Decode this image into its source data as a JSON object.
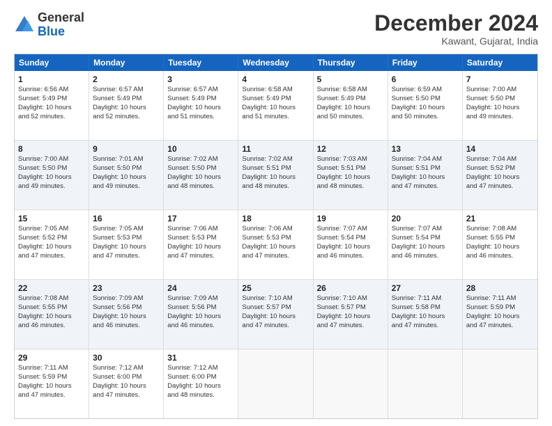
{
  "logo": {
    "general": "General",
    "blue": "Blue"
  },
  "header": {
    "month": "December 2024",
    "location": "Kawant, Gujarat, India"
  },
  "days": [
    "Sunday",
    "Monday",
    "Tuesday",
    "Wednesday",
    "Thursday",
    "Friday",
    "Saturday"
  ],
  "rows": [
    [
      {
        "num": "",
        "empty": true
      },
      {
        "num": "1",
        "lines": [
          "Sunrise: 6:56 AM",
          "Sunset: 5:49 PM",
          "Daylight: 10 hours",
          "and 52 minutes."
        ]
      },
      {
        "num": "2",
        "lines": [
          "Sunrise: 6:57 AM",
          "Sunset: 5:49 PM",
          "Daylight: 10 hours",
          "and 52 minutes."
        ]
      },
      {
        "num": "3",
        "lines": [
          "Sunrise: 6:57 AM",
          "Sunset: 5:49 PM",
          "Daylight: 10 hours",
          "and 51 minutes."
        ]
      },
      {
        "num": "4",
        "lines": [
          "Sunrise: 6:58 AM",
          "Sunset: 5:49 PM",
          "Daylight: 10 hours",
          "and 51 minutes."
        ]
      },
      {
        "num": "5",
        "lines": [
          "Sunrise: 6:58 AM",
          "Sunset: 5:49 PM",
          "Daylight: 10 hours",
          "and 50 minutes."
        ]
      },
      {
        "num": "6",
        "lines": [
          "Sunrise: 6:59 AM",
          "Sunset: 5:50 PM",
          "Daylight: 10 hours",
          "and 50 minutes."
        ]
      },
      {
        "num": "7",
        "lines": [
          "Sunrise: 7:00 AM",
          "Sunset: 5:50 PM",
          "Daylight: 10 hours",
          "and 49 minutes."
        ]
      }
    ],
    [
      {
        "num": "8",
        "lines": [
          "Sunrise: 7:00 AM",
          "Sunset: 5:50 PM",
          "Daylight: 10 hours",
          "and 49 minutes."
        ]
      },
      {
        "num": "9",
        "lines": [
          "Sunrise: 7:01 AM",
          "Sunset: 5:50 PM",
          "Daylight: 10 hours",
          "and 49 minutes."
        ]
      },
      {
        "num": "10",
        "lines": [
          "Sunrise: 7:02 AM",
          "Sunset: 5:50 PM",
          "Daylight: 10 hours",
          "and 48 minutes."
        ]
      },
      {
        "num": "11",
        "lines": [
          "Sunrise: 7:02 AM",
          "Sunset: 5:51 PM",
          "Daylight: 10 hours",
          "and 48 minutes."
        ]
      },
      {
        "num": "12",
        "lines": [
          "Sunrise: 7:03 AM",
          "Sunset: 5:51 PM",
          "Daylight: 10 hours",
          "and 48 minutes."
        ]
      },
      {
        "num": "13",
        "lines": [
          "Sunrise: 7:04 AM",
          "Sunset: 5:51 PM",
          "Daylight: 10 hours",
          "and 47 minutes."
        ]
      },
      {
        "num": "14",
        "lines": [
          "Sunrise: 7:04 AM",
          "Sunset: 5:52 PM",
          "Daylight: 10 hours",
          "and 47 minutes."
        ]
      }
    ],
    [
      {
        "num": "15",
        "lines": [
          "Sunrise: 7:05 AM",
          "Sunset: 5:52 PM",
          "Daylight: 10 hours",
          "and 47 minutes."
        ]
      },
      {
        "num": "16",
        "lines": [
          "Sunrise: 7:05 AM",
          "Sunset: 5:53 PM",
          "Daylight: 10 hours",
          "and 47 minutes."
        ]
      },
      {
        "num": "17",
        "lines": [
          "Sunrise: 7:06 AM",
          "Sunset: 5:53 PM",
          "Daylight: 10 hours",
          "and 47 minutes."
        ]
      },
      {
        "num": "18",
        "lines": [
          "Sunrise: 7:06 AM",
          "Sunset: 5:53 PM",
          "Daylight: 10 hours",
          "and 47 minutes."
        ]
      },
      {
        "num": "19",
        "lines": [
          "Sunrise: 7:07 AM",
          "Sunset: 5:54 PM",
          "Daylight: 10 hours",
          "and 46 minutes."
        ]
      },
      {
        "num": "20",
        "lines": [
          "Sunrise: 7:07 AM",
          "Sunset: 5:54 PM",
          "Daylight: 10 hours",
          "and 46 minutes."
        ]
      },
      {
        "num": "21",
        "lines": [
          "Sunrise: 7:08 AM",
          "Sunset: 5:55 PM",
          "Daylight: 10 hours",
          "and 46 minutes."
        ]
      }
    ],
    [
      {
        "num": "22",
        "lines": [
          "Sunrise: 7:08 AM",
          "Sunset: 5:55 PM",
          "Daylight: 10 hours",
          "and 46 minutes."
        ]
      },
      {
        "num": "23",
        "lines": [
          "Sunrise: 7:09 AM",
          "Sunset: 5:56 PM",
          "Daylight: 10 hours",
          "and 46 minutes."
        ]
      },
      {
        "num": "24",
        "lines": [
          "Sunrise: 7:09 AM",
          "Sunset: 5:56 PM",
          "Daylight: 10 hours",
          "and 46 minutes."
        ]
      },
      {
        "num": "25",
        "lines": [
          "Sunrise: 7:10 AM",
          "Sunset: 5:57 PM",
          "Daylight: 10 hours",
          "and 47 minutes."
        ]
      },
      {
        "num": "26",
        "lines": [
          "Sunrise: 7:10 AM",
          "Sunset: 5:57 PM",
          "Daylight: 10 hours",
          "and 47 minutes."
        ]
      },
      {
        "num": "27",
        "lines": [
          "Sunrise: 7:11 AM",
          "Sunset: 5:58 PM",
          "Daylight: 10 hours",
          "and 47 minutes."
        ]
      },
      {
        "num": "28",
        "lines": [
          "Sunrise: 7:11 AM",
          "Sunset: 5:59 PM",
          "Daylight: 10 hours",
          "and 47 minutes."
        ]
      }
    ],
    [
      {
        "num": "29",
        "lines": [
          "Sunrise: 7:11 AM",
          "Sunset: 5:59 PM",
          "Daylight: 10 hours",
          "and 47 minutes."
        ]
      },
      {
        "num": "30",
        "lines": [
          "Sunrise: 7:12 AM",
          "Sunset: 6:00 PM",
          "Daylight: 10 hours",
          "and 47 minutes."
        ]
      },
      {
        "num": "31",
        "lines": [
          "Sunrise: 7:12 AM",
          "Sunset: 6:00 PM",
          "Daylight: 10 hours",
          "and 48 minutes."
        ]
      },
      {
        "num": "",
        "empty": true
      },
      {
        "num": "",
        "empty": true
      },
      {
        "num": "",
        "empty": true
      },
      {
        "num": "",
        "empty": true
      }
    ]
  ]
}
